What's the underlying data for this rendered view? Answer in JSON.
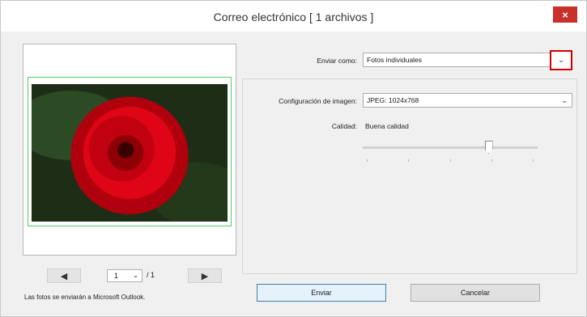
{
  "window": {
    "title": "Correo electrónico [ 1 archivos ]",
    "close_glyph": "×"
  },
  "preview": {
    "prev_glyph": "◀",
    "next_glyph": "▶",
    "page_current": "1",
    "page_total": "/ 1",
    "note": "Las fotos se enviarán a Microsoft Outlook."
  },
  "send_as": {
    "label": "Enviar como:",
    "value": "Fotos individuales"
  },
  "image_config": {
    "label": "Configuración de imagen:",
    "value": "JPEG: 1024x768"
  },
  "quality": {
    "label": "Calidad:",
    "value": "Buena calidad",
    "slider_level": 0.72
  },
  "buttons": {
    "send": "Enviar",
    "cancel": "Cancelar"
  },
  "colors": {
    "highlight": "#d00000",
    "close": "#c7312a",
    "frame": "#4ccf5a"
  },
  "icons": {
    "chevron": "⌄"
  }
}
